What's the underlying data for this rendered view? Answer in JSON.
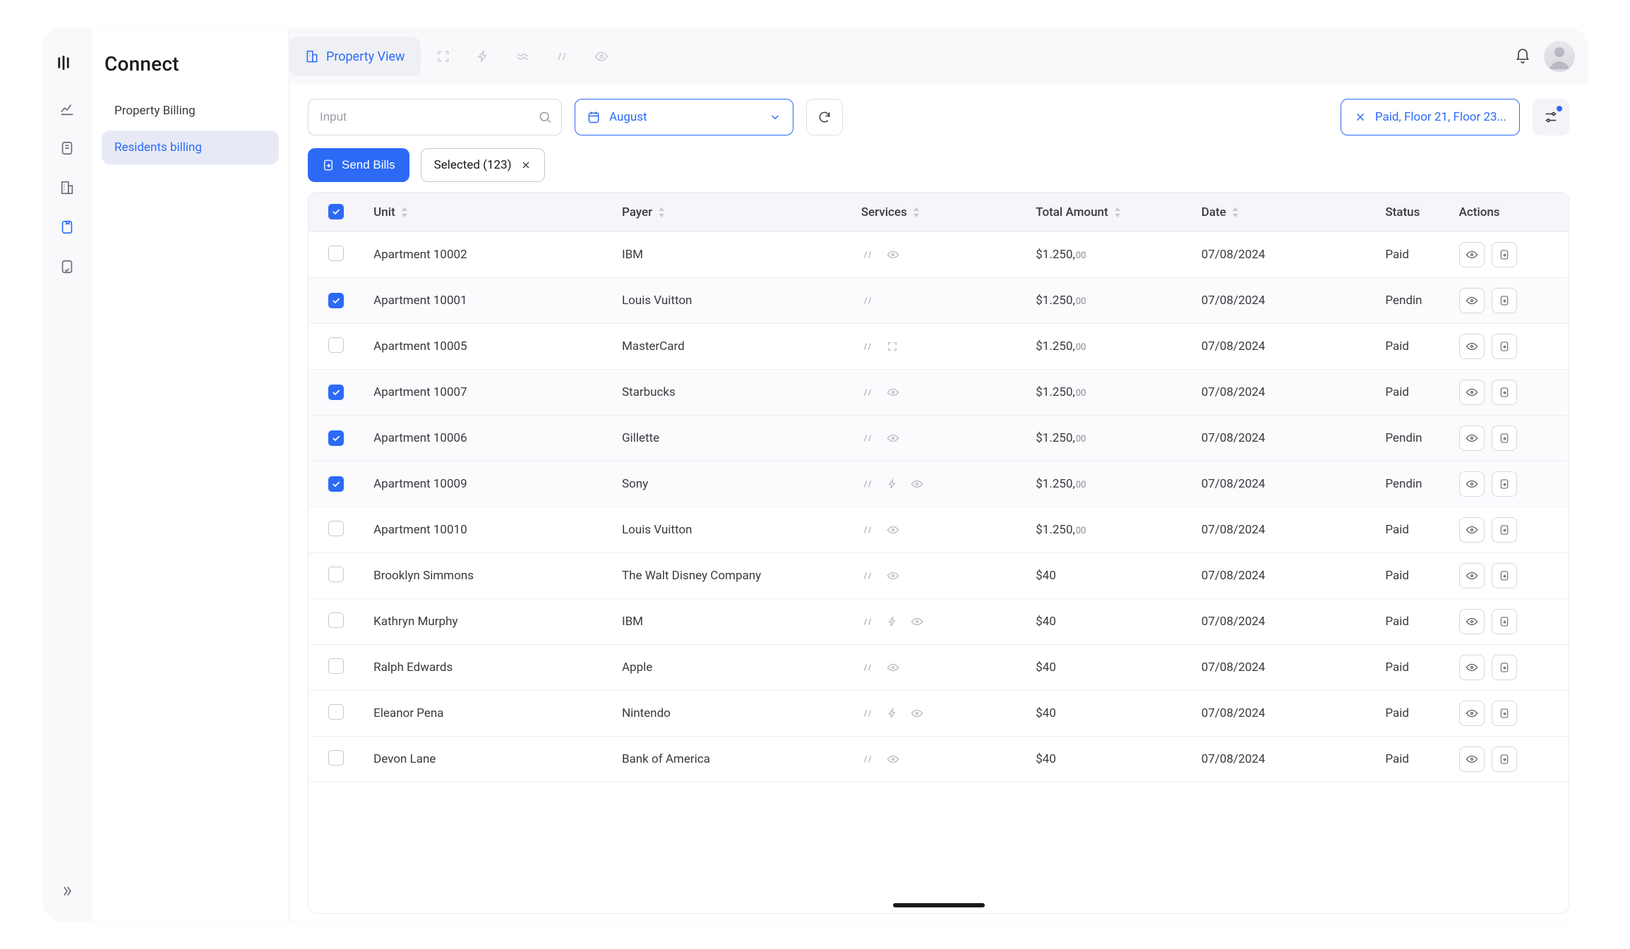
{
  "brand": {
    "name": "Connect"
  },
  "sidenav": {
    "items": [
      {
        "label": "Property Billing",
        "active": false
      },
      {
        "label": "Residents billing",
        "active": true
      }
    ]
  },
  "topbar": {
    "active_tab": {
      "label": "Property View"
    }
  },
  "filters": {
    "search_placeholder": "Input",
    "month": "August",
    "applied_pill": "Paid, Floor 21, Floor 23..."
  },
  "actions": {
    "send_bills": "Send Bills",
    "selected_chip": "Selected (123)"
  },
  "table": {
    "headers": {
      "unit": "Unit",
      "payer": "Payer",
      "services": "Services",
      "total": "Total Amount",
      "date": "Date",
      "status": "Status",
      "actions": "Actions"
    },
    "rows": [
      {
        "checked": false,
        "unit": "Apartment 10002",
        "payer": "IBM",
        "services": [
          "waves",
          "eye"
        ],
        "amount": "$1.250,",
        "amount_dec": "00",
        "date": "07/08/2024",
        "status": "Paid"
      },
      {
        "checked": true,
        "unit": "Apartment 10001",
        "payer": "Louis Vuitton",
        "services": [
          "waves"
        ],
        "amount": "$1.250,",
        "amount_dec": "00",
        "date": "07/08/2024",
        "status": "Pendin"
      },
      {
        "checked": false,
        "unit": "Apartment 10005",
        "payer": "MasterCard",
        "services": [
          "waves",
          "expand"
        ],
        "amount": "$1.250,",
        "amount_dec": "00",
        "date": "07/08/2024",
        "status": "Paid"
      },
      {
        "checked": true,
        "unit": "Apartment 10007",
        "payer": "Starbucks",
        "services": [
          "waves",
          "eye"
        ],
        "amount": "$1.250,",
        "amount_dec": "00",
        "date": "07/08/2024",
        "status": "Paid"
      },
      {
        "checked": true,
        "unit": "Apartment 10006",
        "payer": "Gillette",
        "services": [
          "waves",
          "eye"
        ],
        "amount": "$1.250,",
        "amount_dec": "00",
        "date": "07/08/2024",
        "status": "Pendin"
      },
      {
        "checked": true,
        "unit": "Apartment 10009",
        "payer": "Sony",
        "services": [
          "waves",
          "bolt",
          "eye"
        ],
        "amount": "$1.250,",
        "amount_dec": "00",
        "date": "07/08/2024",
        "status": "Pendin"
      },
      {
        "checked": false,
        "unit": "Apartment 10010",
        "payer": "Louis Vuitton",
        "services": [
          "waves",
          "eye"
        ],
        "amount": "$1.250,",
        "amount_dec": "00",
        "date": "07/08/2024",
        "status": "Paid"
      },
      {
        "checked": false,
        "unit": "Brooklyn Simmons",
        "payer": "The Walt Disney Company",
        "services": [
          "waves",
          "eye"
        ],
        "amount": "$40",
        "amount_dec": "",
        "date": "07/08/2024",
        "status": "Paid"
      },
      {
        "checked": false,
        "unit": "Kathryn Murphy",
        "payer": "IBM",
        "services": [
          "waves",
          "bolt",
          "eye"
        ],
        "amount": "$40",
        "amount_dec": "",
        "date": "07/08/2024",
        "status": "Paid"
      },
      {
        "checked": false,
        "unit": "Ralph Edwards",
        "payer": "Apple",
        "services": [
          "waves",
          "eye"
        ],
        "amount": "$40",
        "amount_dec": "",
        "date": "07/08/2024",
        "status": "Paid"
      },
      {
        "checked": false,
        "unit": "Eleanor Pena",
        "payer": "Nintendo",
        "services": [
          "waves",
          "bolt",
          "eye"
        ],
        "amount": "$40",
        "amount_dec": "",
        "date": "07/08/2024",
        "status": "Paid"
      },
      {
        "checked": false,
        "unit": "Devon Lane",
        "payer": "Bank of America",
        "services": [
          "waves",
          "eye"
        ],
        "amount": "$40",
        "amount_dec": "",
        "date": "07/08/2024",
        "status": "Paid"
      }
    ]
  }
}
